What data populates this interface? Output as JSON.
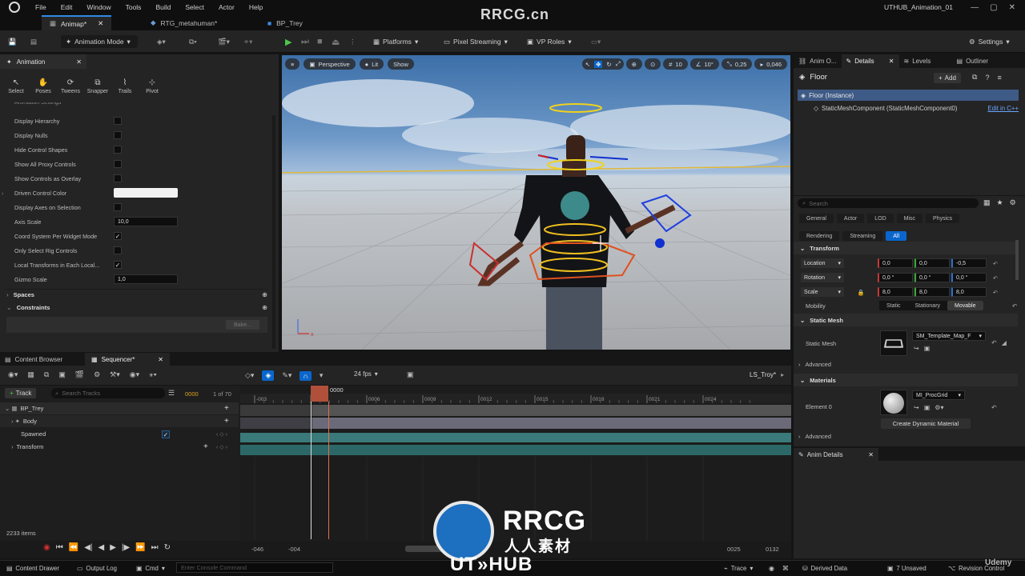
{
  "menubar": {
    "items": [
      "File",
      "Edit",
      "Window",
      "Tools",
      "Build",
      "Select",
      "Actor",
      "Help"
    ],
    "project": "UTHUB_Animation_01"
  },
  "tabs": [
    {
      "label": "Animap*"
    },
    {
      "label": "RTG_metahuman*"
    },
    {
      "label": "BP_Trey"
    }
  ],
  "toolbar": {
    "mode": "Animation Mode",
    "platforms": "Platforms",
    "pixel_streaming": "Pixel Streaming",
    "vp_roles": "VP Roles",
    "settings": "Settings"
  },
  "animation_panel": {
    "title": "Animation",
    "tools": [
      "Select",
      "Poses",
      "Tweens",
      "Snapper",
      "Trails",
      "Pivot"
    ],
    "section_header": "Animation Settings",
    "props": [
      {
        "label": "Display Hierarchy",
        "type": "check",
        "checked": false
      },
      {
        "label": "Display Nulls",
        "type": "check",
        "checked": false
      },
      {
        "label": "Hide Control Shapes",
        "type": "check",
        "checked": false
      },
      {
        "label": "Show All Proxy Controls",
        "type": "check",
        "checked": false
      },
      {
        "label": "Show Controls as Overlay",
        "type": "check",
        "checked": false
      },
      {
        "label": "Driven Control Color",
        "type": "color"
      },
      {
        "label": "Display Axes on Selection",
        "type": "check",
        "checked": false
      },
      {
        "label": "Axis Scale",
        "type": "value",
        "value": "10,0"
      },
      {
        "label": "Coord System Per Widget Mode",
        "type": "check",
        "checked": true
      },
      {
        "label": "Only Select Rig Controls",
        "type": "check",
        "checked": false
      },
      {
        "label": "Local Transforms in Each Local...",
        "type": "check",
        "checked": true
      },
      {
        "label": "Gizmo Scale",
        "type": "value",
        "value": "1,0"
      }
    ],
    "spaces": "Spaces",
    "constraints": "Constraints",
    "bake": "Bake..."
  },
  "viewport": {
    "perspective": "Perspective",
    "lit": "Lit",
    "show": "Show",
    "grid": "10",
    "angle": "10°",
    "scale": "0,25",
    "speed": "0,046"
  },
  "outliner": {
    "tabs": [
      "Anim O...",
      "Details",
      "Levels",
      "Outliner"
    ],
    "object": "Floor",
    "add": "Add",
    "instance": "Floor (Instance)",
    "component": "StaticMeshComponent (StaticMeshComponent0)",
    "edit_cpp": "Edit in C++",
    "search_placeholder": "Search",
    "categories": [
      "General",
      "Actor",
      "LOD",
      "Misc",
      "Physics",
      "Rendering",
      "Streaming",
      "All"
    ],
    "transform": {
      "header": "Transform",
      "location": {
        "label": "Location",
        "x": "0,0",
        "y": "0,0",
        "z": "-0,5"
      },
      "rotation": {
        "label": "Rotation",
        "x": "0,0 °",
        "y": "0,0 °",
        "z": "0,0 °"
      },
      "scale": {
        "label": "Scale",
        "x": "8,0",
        "y": "8,0",
        "z": "8,0"
      },
      "mobility": {
        "label": "Mobility",
        "options": [
          "Static",
          "Stationary",
          "Movable"
        ]
      }
    },
    "static_mesh": {
      "header": "Static Mesh",
      "label": "Static Mesh",
      "value": "SM_Template_Map_F"
    },
    "advanced": "Advanced",
    "materials": {
      "header": "Materials",
      "element": "Element 0",
      "value": "MI_ProcGrid",
      "create": "Create Dynamic Material"
    },
    "anim_details": "Anim Details"
  },
  "content_browser": {
    "tab": "Content Browser",
    "items": "2233 items"
  },
  "sequencer": {
    "tab": "Sequencer*",
    "fps": "24 fps",
    "sequence": "LS_Troy*",
    "add_track": "Track",
    "search_placeholder": "Search Tracks",
    "frame": "0000",
    "frame_of": "1 of 70",
    "playhead": "0000",
    "ruler": [
      "-003",
      "0003",
      "0006",
      "0009",
      "0012",
      "0015",
      "0018",
      "0021",
      "0024"
    ],
    "tracks": [
      {
        "label": "BP_Trey"
      },
      {
        "label": "Body"
      },
      {
        "label": "Spawned"
      },
      {
        "label": "Transform"
      }
    ],
    "range_start": "-046",
    "range_start2": "-004",
    "range_end": "0025",
    "range_end2": "0132"
  },
  "statusbar": {
    "content_drawer": "Content Drawer",
    "output_log": "Output Log",
    "cmd": "Cmd",
    "console_placeholder": "Enter Console Command",
    "trace": "Trace",
    "derived_data": "Derived Data",
    "unsaved": "7 Unsaved",
    "revision": "Revision Control"
  },
  "watermarks": {
    "top": "RRCG.cn",
    "center1": "RRCG",
    "center2": "人人素材",
    "bottom": "UT»HUB",
    "udemy": "Udemy"
  }
}
